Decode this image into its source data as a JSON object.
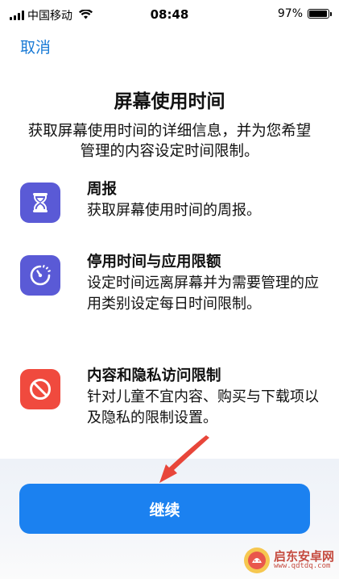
{
  "status_bar": {
    "carrier": "中国移动",
    "time": "08:48",
    "battery_percent": "97%",
    "battery_level": 0.97,
    "signal_bars": 4
  },
  "nav": {
    "cancel_label": "取消"
  },
  "header": {
    "title": "屏幕使用时间",
    "subtitle": "获取屏幕使用时间的详细信息，并为您希望管理的内容设定时间限制。"
  },
  "features": [
    {
      "icon": "hourglass-icon",
      "color": "#5a5ad6",
      "title": "周报",
      "description": "获取屏幕使用时间的周报。"
    },
    {
      "icon": "downtime-icon",
      "color": "#5a5ad6",
      "title": "停用时间与应用限额",
      "description": "设定时间远离屏幕并为需要管理的应用类别设定每日时间限制。"
    },
    {
      "icon": "restriction-icon",
      "color": "#f04a3e",
      "title": "内容和隐私访问限制",
      "description": "针对儿童不宜内容、购买与下载项以及隐私的限制设置。"
    }
  ],
  "footer": {
    "continue_label": "继续",
    "accent": "#1b81f0"
  },
  "overlay": {
    "arrow_color": "#e8463a"
  },
  "watermark": {
    "name": "启东安卓网",
    "url": "www.qdtdq.com"
  }
}
